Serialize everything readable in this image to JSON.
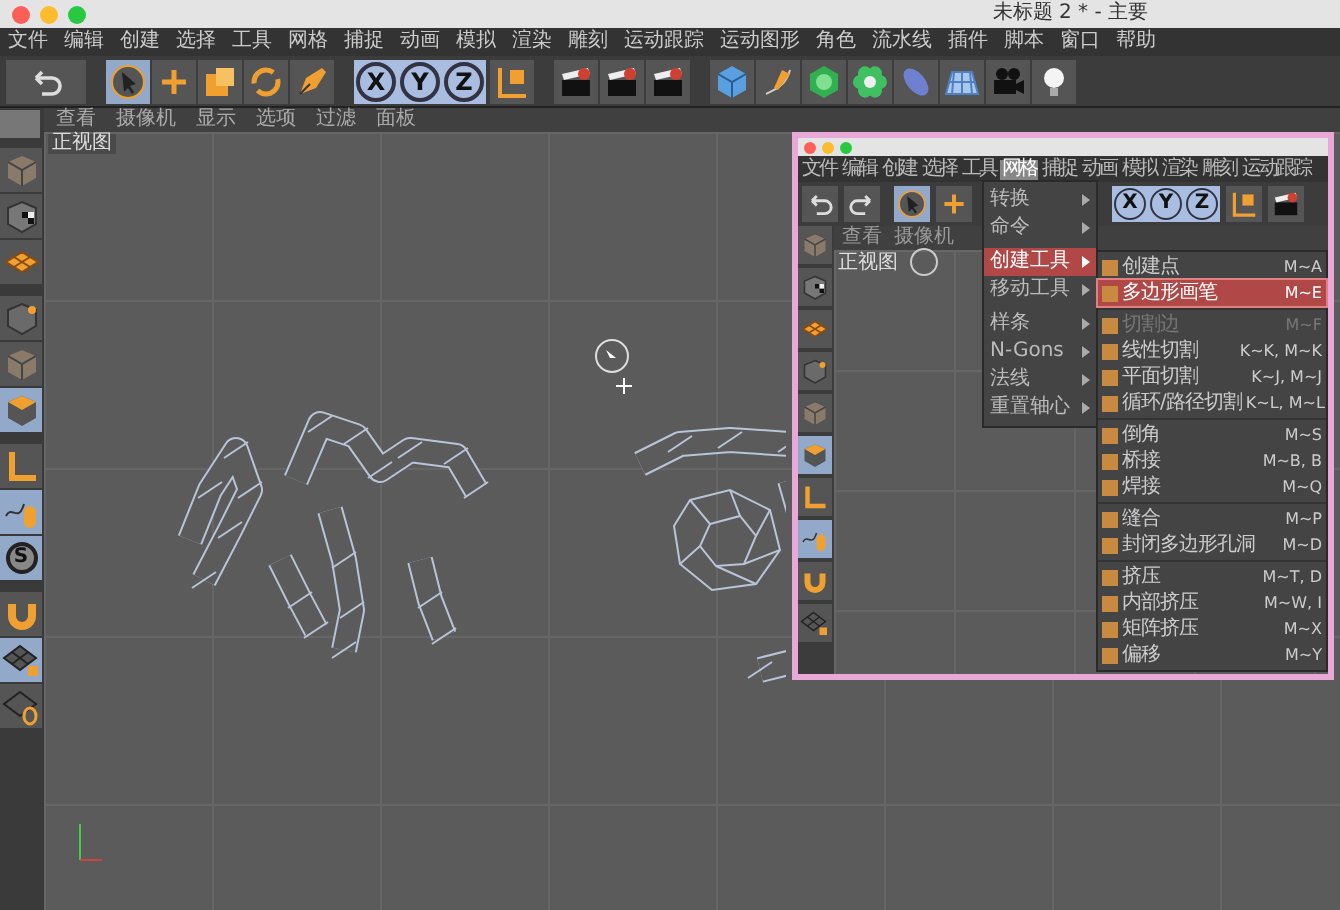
{
  "window": {
    "title": "未标题 2 * - 主要"
  },
  "menu": [
    "文件",
    "编辑",
    "创建",
    "选择",
    "工具",
    "网格",
    "捕捉",
    "动画",
    "模拟",
    "渲染",
    "雕刻",
    "运动跟踪",
    "运动图形",
    "角色",
    "流水线",
    "插件",
    "脚本",
    "窗口",
    "帮助"
  ],
  "axis_buttons": [
    "X",
    "Y",
    "Z"
  ],
  "tool_letter": "S",
  "viewport": {
    "menu": [
      "查看",
      "摄像机",
      "显示",
      "选项",
      "过滤",
      "面板"
    ],
    "label": "正视图"
  },
  "inset": {
    "menu": [
      {
        "label": "文件",
        "selected": false
      },
      {
        "label": "编辑",
        "selected": false
      },
      {
        "label": "创建",
        "selected": false
      },
      {
        "label": "选择",
        "selected": false
      },
      {
        "label": "工具",
        "selected": false
      },
      {
        "label": "网格",
        "selected": true
      },
      {
        "label": "捕捉",
        "selected": false
      },
      {
        "label": "动画",
        "selected": false
      },
      {
        "label": "模拟",
        "selected": false
      },
      {
        "label": "渲染",
        "selected": false
      },
      {
        "label": "雕刻",
        "selected": false
      },
      {
        "label": "运动跟踪",
        "selected": false
      }
    ],
    "axis_buttons": [
      "X",
      "Y",
      "Z"
    ],
    "view_menu": [
      "查看",
      "摄像机"
    ],
    "view_label": "正视图",
    "dropdown": [
      {
        "label": "转换",
        "selected": false
      },
      {
        "label": "命令",
        "selected": false
      },
      {
        "label": "创建工具",
        "selected": true
      },
      {
        "label": "移动工具",
        "selected": false
      },
      {
        "label": "样条",
        "selected": false
      },
      {
        "label": "N-Gons",
        "selected": false
      },
      {
        "label": "法线",
        "selected": false
      },
      {
        "label": "重置轴心",
        "selected": false
      }
    ],
    "submenu": [
      [
        {
          "label": "创建点",
          "shortcut": "M~A",
          "selected": false,
          "disabled": false
        },
        {
          "label": "多边形画笔",
          "shortcut": "M~E",
          "selected": true,
          "disabled": false
        }
      ],
      [
        {
          "label": "切割边",
          "shortcut": "M~F",
          "selected": false,
          "disabled": true
        },
        {
          "label": "线性切割",
          "shortcut": "K~K, M~K",
          "selected": false,
          "disabled": false
        },
        {
          "label": "平面切割",
          "shortcut": "K~J, M~J",
          "selected": false,
          "disabled": false
        },
        {
          "label": "循环/路径切割",
          "shortcut": "K~L, M~L",
          "selected": false,
          "disabled": false
        }
      ],
      [
        {
          "label": "倒角",
          "shortcut": "M~S",
          "selected": false,
          "disabled": false
        },
        {
          "label": "桥接",
          "shortcut": "M~B, B",
          "selected": false,
          "disabled": false
        },
        {
          "label": "焊接",
          "shortcut": "M~Q",
          "selected": false,
          "disabled": false
        }
      ],
      [
        {
          "label": "缝合",
          "shortcut": "M~P",
          "selected": false,
          "disabled": false
        },
        {
          "label": "封闭多边形孔洞",
          "shortcut": "M~D",
          "selected": false,
          "disabled": false
        }
      ],
      [
        {
          "label": "挤压",
          "shortcut": "M~T, D",
          "selected": false,
          "disabled": false
        },
        {
          "label": "内部挤压",
          "shortcut": "M~W, I",
          "selected": false,
          "disabled": false
        },
        {
          "label": "矩阵挤压",
          "shortcut": "M~X",
          "selected": false,
          "disabled": false
        },
        {
          "label": "偏移",
          "shortcut": "M~Y",
          "selected": false,
          "disabled": false
        }
      ]
    ]
  }
}
